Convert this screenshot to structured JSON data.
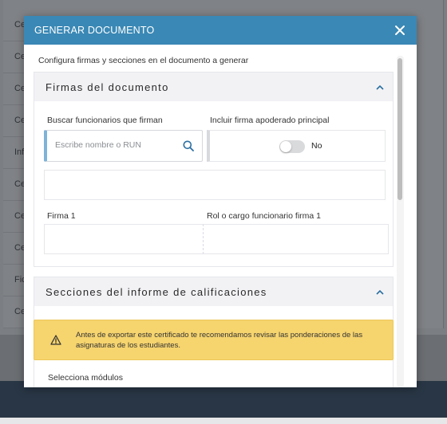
{
  "background": {
    "rows": [
      {
        "label": "Ce"
      },
      {
        "label": "Ce"
      },
      {
        "label": "Ce"
      },
      {
        "label": "Ce"
      },
      {
        "label": "Inf"
      },
      {
        "label": "Ce"
      },
      {
        "label": "Ce"
      },
      {
        "label": "Ce"
      },
      {
        "label": "Fic"
      },
      {
        "label": "Ce"
      }
    ]
  },
  "modal": {
    "title": "GENERAR DOCUMENTO",
    "intro": "Configura firmas y secciones en el documento a generar",
    "signatures_section": {
      "title": "Firmas del documento",
      "search_label": "Buscar funcionarios que firman",
      "search_placeholder": "Escribe nombre o RUN",
      "include_label": "Incluir firma apoderado principal",
      "toggle_value": "No",
      "signer_label": "Firma 1",
      "role_label": "Rol o cargo funcionario firma 1"
    },
    "sections_section": {
      "title": "Secciones del informe de calificaciones"
    },
    "alert": {
      "text": "Antes de exportar este certificado te recomendamos revisar las ponderaciones de las asignaturas de los estudiantes."
    },
    "cut_label": "Selecciona módulos"
  },
  "colors": {
    "header": "#3a88b5",
    "alert": "#f6d46e",
    "accent": "#2b6fa0"
  }
}
